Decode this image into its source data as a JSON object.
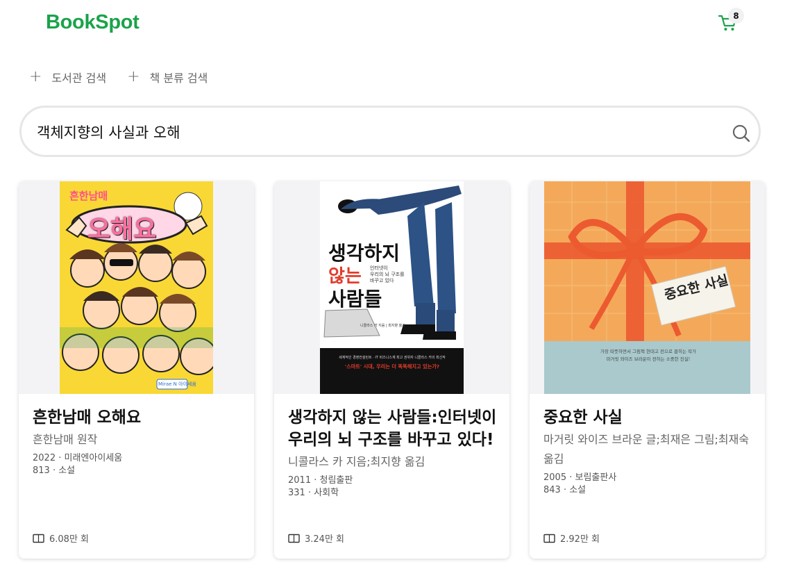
{
  "header": {
    "logo": "BookSpot",
    "cart_count": "8"
  },
  "filters": [
    {
      "label": "도서관 검색"
    },
    {
      "label": "책 분류 검색"
    }
  ],
  "search": {
    "value": "객체지향의 사실과 오해"
  },
  "books": [
    {
      "title": "흔한남매 오해요",
      "author": "흔한남매 원작",
      "year_publisher": "2022 · 미래엔아이세움",
      "class": "813 · 소설",
      "reads": "6.08만 회",
      "cover": {
        "brand": "흔한남매",
        "title": "오해요",
        "publisher": "Mirae N 아이세움",
        "colors": {
          "bg": "#f9d835",
          "title": "#ff6ea1"
        }
      }
    },
    {
      "title": "생각하지 않는 사람들:인터넷이 우리의 뇌 구조를 바꾸고 있다!",
      "author": "니콜라스 카 지음;최지향 옮김",
      "year_publisher": "2011 · 청림출판",
      "class": "331 · 사회학",
      "reads": "3.24만 회",
      "cover": {
        "title_line1": "생각하지",
        "title_line2": "않는",
        "title_line3": "사람들",
        "subtitle_line1": "인터넷이",
        "subtitle_line2": "우리의 뇌 구조를",
        "subtitle_line3": "바꾸고 있다",
        "authors": "니콜라스 카 지음 | 최지향 옮김",
        "blurb": "세계적인 경영컨설턴트 · IT 비즈니스계 최고 권위자 니콜라스 카의 최신작",
        "tagline": "'스마트' 시대, 우리는 더 똑똑해지고 있는가?",
        "colors": {
          "bg": "#ffffff",
          "band": "#111111",
          "accent": "#e23c2b"
        }
      }
    },
    {
      "title": "중요한 사실",
      "author": "마거릿 와이즈 브라운 글;최재은 그림;최재숙 옮김",
      "year_publisher": "2005 · 보림출판사",
      "class": "843 · 소설",
      "reads": "2.92만 회",
      "cover": {
        "title": "중요한 사실",
        "blurb_line1": "가장 따뜻하면서 그림책 현대고 전으로 꼽히는 작가",
        "blurb_line2": "마거릿 와이즈 브라운이 전하는 소중한 진실!",
        "colors": {
          "bg": "#f4a95a",
          "ribbon": "#ec5a30",
          "band": "#a9c9cc"
        }
      }
    }
  ],
  "colors": {
    "brand": "#1aa34a",
    "muted": "#666666"
  }
}
